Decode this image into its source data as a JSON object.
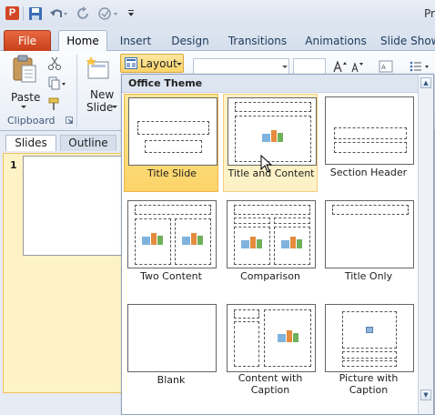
{
  "window": {
    "title_partial": "Pr",
    "app_icon_letter": "P"
  },
  "tabs": [
    {
      "label": "File"
    },
    {
      "label": "Home"
    },
    {
      "label": "Insert"
    },
    {
      "label": "Design"
    },
    {
      "label": "Transitions"
    },
    {
      "label": "Animations"
    },
    {
      "label": "Slide Show"
    }
  ],
  "ribbon": {
    "paste_label": "Paste",
    "new_slide_label": "New Slide",
    "new_slide_line1": "New",
    "new_slide_line2": "Slide",
    "layout_label": "Layout",
    "clipboard_label": "Clipboard"
  },
  "left_pane": {
    "tabs": [
      {
        "label": "Slides"
      },
      {
        "label": "Outline"
      }
    ],
    "slide_number": "1"
  },
  "gallery": {
    "header": "Office Theme",
    "layouts": [
      {
        "label": "Title Slide"
      },
      {
        "label": "Title and Content"
      },
      {
        "label": "Section Header"
      },
      {
        "label": "Two Content"
      },
      {
        "label": "Comparison"
      },
      {
        "label": "Title Only"
      },
      {
        "label": "Blank"
      },
      {
        "label": "Content with Caption"
      },
      {
        "label": "Picture with Caption"
      }
    ],
    "selected_index": 0,
    "hover_index": 1
  },
  "colors": {
    "file_tab": "#d24726",
    "selection": "#fcd368",
    "ribbon_bg": "#e7edf6"
  },
  "icons": [
    "save-icon",
    "undo-icon",
    "redo-icon",
    "paste-icon",
    "cut-icon",
    "copy-icon",
    "format-painter-icon",
    "new-slide-icon",
    "layout-icon",
    "scroll-up-icon",
    "scroll-down-icon",
    "mouse-cursor-icon"
  ]
}
